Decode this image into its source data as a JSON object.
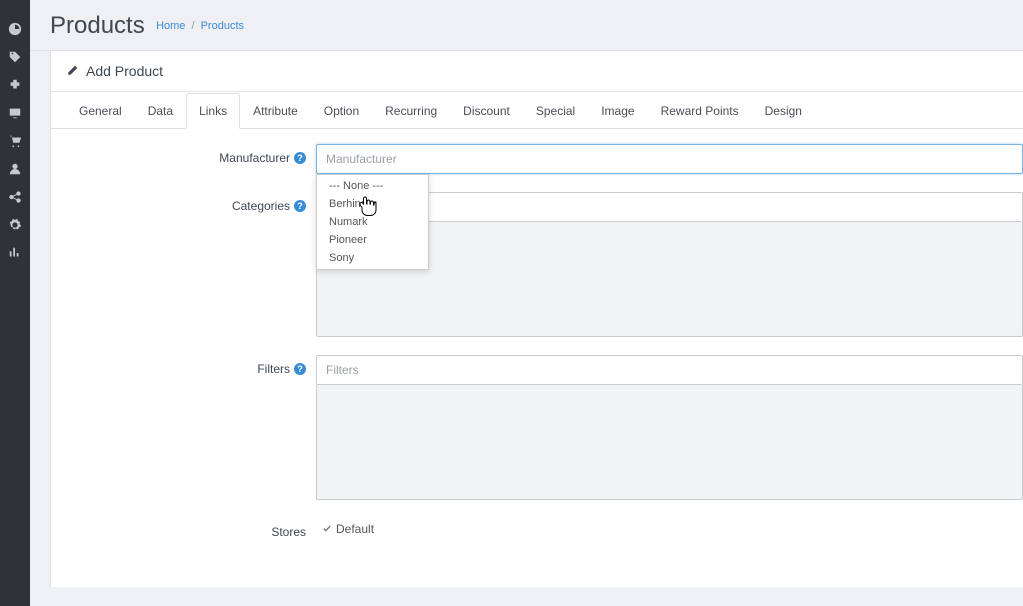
{
  "sidebar": {
    "items": [
      "dashboard",
      "tags",
      "extensions",
      "display",
      "cart",
      "user",
      "share",
      "gear",
      "stats"
    ]
  },
  "header": {
    "title": "Products",
    "breadcrumb": {
      "home": "Home",
      "current": "Products"
    }
  },
  "panel": {
    "heading": "Add Product"
  },
  "tabs": {
    "items": [
      "General",
      "Data",
      "Links",
      "Attribute",
      "Option",
      "Recurring",
      "Discount",
      "Special",
      "Image",
      "Reward Points",
      "Design"
    ],
    "active_index": 2
  },
  "form": {
    "manufacturer": {
      "label": "Manufacturer",
      "placeholder": "Manufacturer",
      "options": [
        "--- None ---",
        "Berhinger",
        "Numark",
        "Pioneer",
        "Sony"
      ]
    },
    "categories": {
      "label": "Categories",
      "placeholder": ""
    },
    "filters": {
      "label": "Filters",
      "placeholder": "Filters"
    },
    "stores": {
      "label": "Stores",
      "value": "Default"
    }
  }
}
